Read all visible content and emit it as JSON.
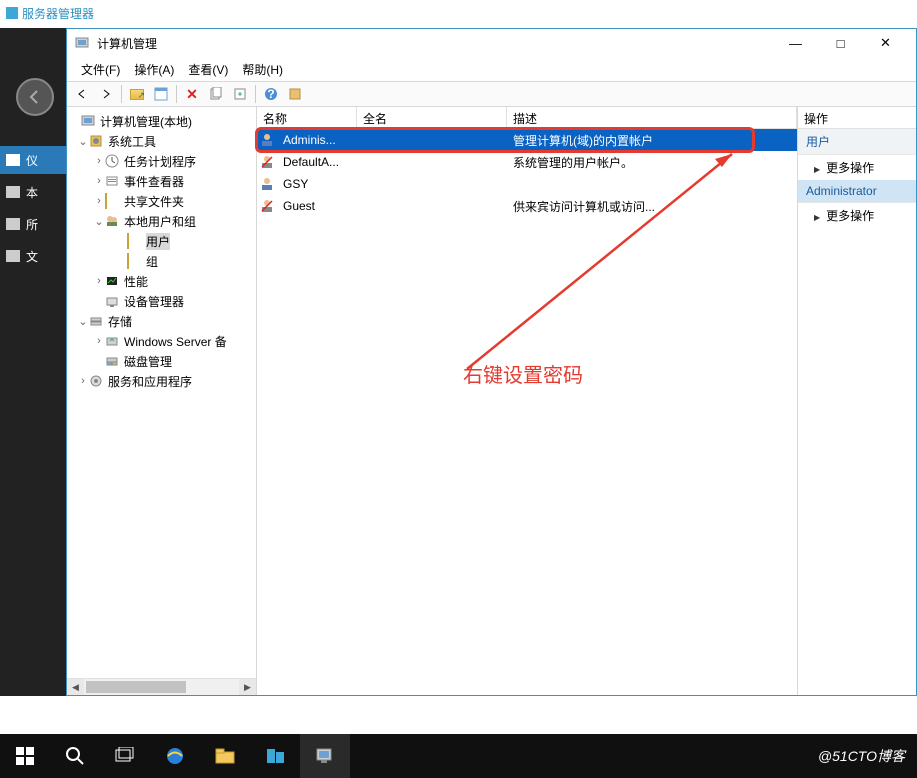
{
  "server_manager": {
    "title": "服务器管理器",
    "nav_items": [
      "仪",
      "本",
      "所",
      "文"
    ]
  },
  "cm": {
    "title": "计算机管理",
    "menu": {
      "file": "文件(F)",
      "action": "操作(A)",
      "view": "查看(V)",
      "help": "帮助(H)"
    },
    "tree": {
      "root": "计算机管理(本地)",
      "sys_tools": "系统工具",
      "task_sched": "任务计划程序",
      "event_viewer": "事件查看器",
      "shared": "共享文件夹",
      "local_users": "本地用户和组",
      "users": "用户",
      "groups": "组",
      "perf": "性能",
      "devmgr": "设备管理器",
      "storage": "存储",
      "wsb": "Windows Server 备",
      "diskmgmt": "磁盘管理",
      "services": "服务和应用程序"
    },
    "columns": {
      "name": "名称",
      "fullname": "全名",
      "desc": "描述"
    },
    "users": [
      {
        "name": "Adminis...",
        "fullname": "",
        "desc": "管理计算机(域)的内置帐户"
      },
      {
        "name": "DefaultA...",
        "fullname": "",
        "desc": "系统管理的用户帐户。"
      },
      {
        "name": "GSY",
        "fullname": "",
        "desc": ""
      },
      {
        "name": "Guest",
        "fullname": "",
        "desc": "供来宾访问计算机或访问..."
      }
    ],
    "actions": {
      "header": "操作",
      "group1": "用户",
      "more1": "更多操作",
      "group2": "Administrator",
      "more2": "更多操作"
    }
  },
  "annotation": {
    "text": "右键设置密码"
  },
  "watermark": "@51CTO博客"
}
